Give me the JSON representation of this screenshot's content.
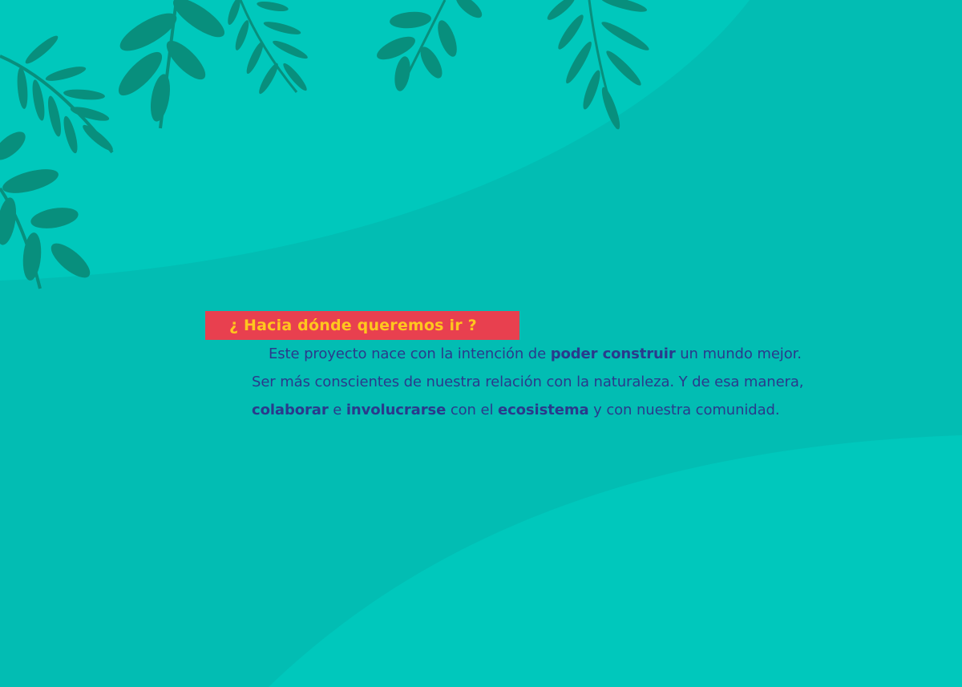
{
  "section": {
    "heading": "¿ Hacia dónde queremos ir ?"
  },
  "paragraph": {
    "part1": "Este proyecto nace con la intención de ",
    "bold1": "poder construir",
    "part2": " un mundo mejor. Ser más conscientes de nuestra relación con la naturaleza. Y de esa manera, ",
    "bold2": "colaborar",
    "part3": " e ",
    "bold3": "involucrarse",
    "part4": " con el ",
    "bold4": "ecosistema",
    "part5": " y con nuestra comunidad."
  },
  "colors": {
    "background": "#02bdb3",
    "light_wave": "#00c8bc",
    "leaves": "#088f7d",
    "heading_box": "#e8404f",
    "heading_text": "#ffc61e",
    "body_text": "#2a3a8c"
  },
  "decorations": {
    "icons": [
      "leaf-branch-icon"
    ]
  }
}
